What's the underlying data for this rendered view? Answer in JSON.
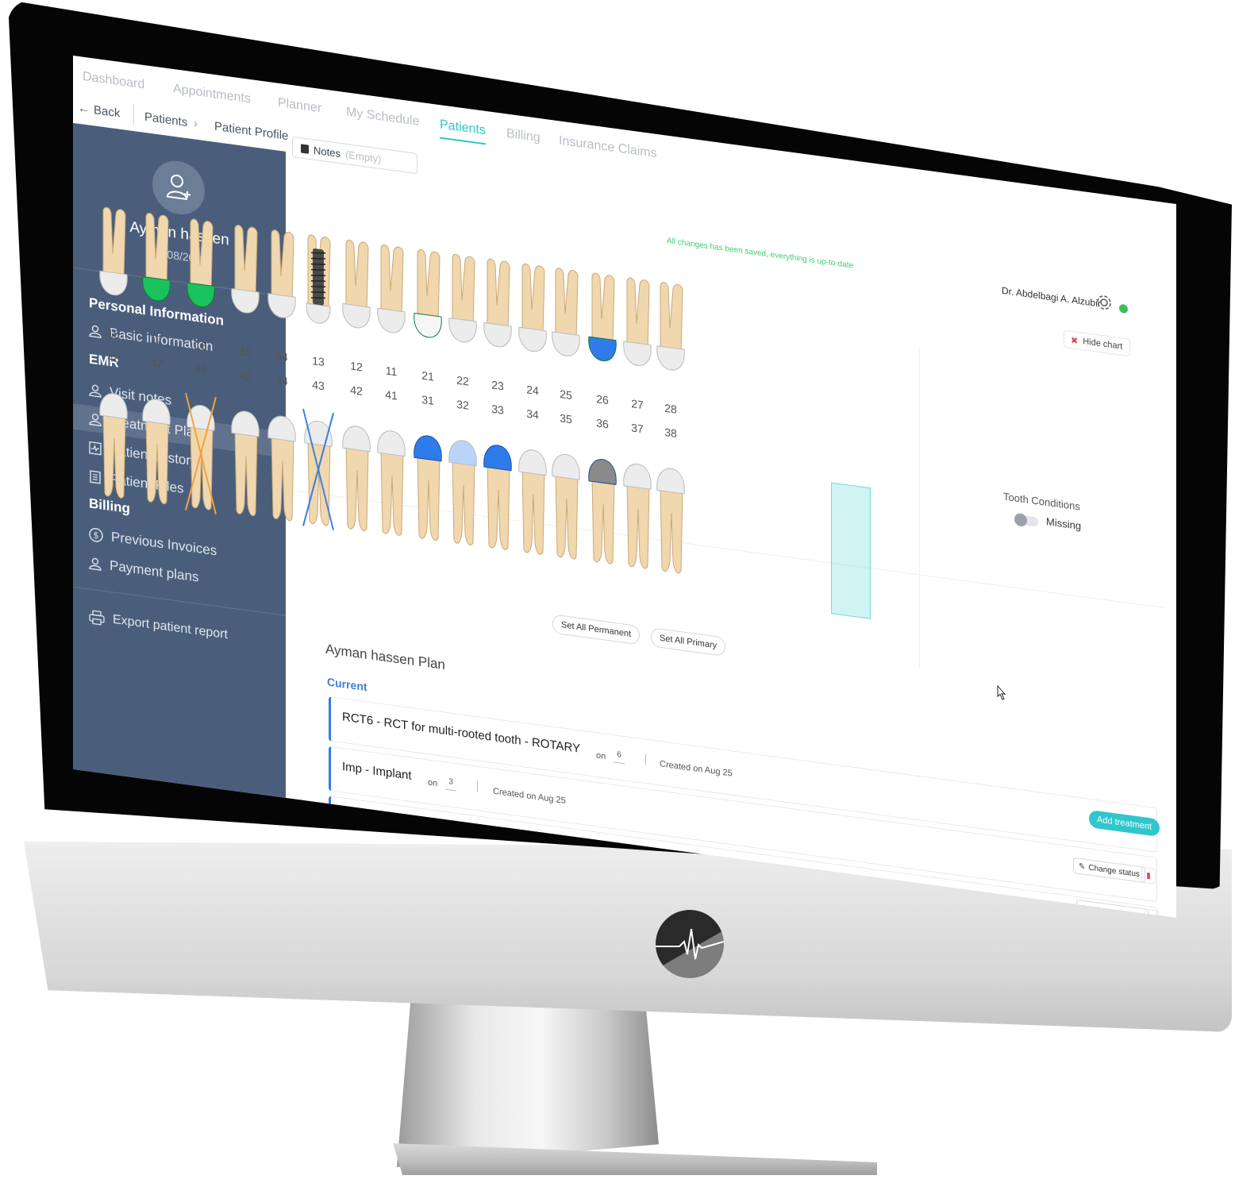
{
  "colors": {
    "accent": "#2fc4c9",
    "sidebar": "#4a5e7c",
    "primary_blue": "#3b7fe0",
    "saved_green": "#3fcf72"
  },
  "topnav": {
    "tabs": [
      "Dashboard",
      "Appointments",
      "Planner",
      "My Schedule",
      "Patients",
      "Billing",
      "Insurance Claims"
    ],
    "active": "Patients"
  },
  "breadcrumb": {
    "back": "Back",
    "items": [
      "Patients",
      "Patient Profile"
    ]
  },
  "patient": {
    "name": "Ayman hassen",
    "dob": "22/08/2009"
  },
  "sidebar": {
    "personal_heading": "Personal Information",
    "basic_info": "Basic information",
    "emr_heading": "EMR",
    "visit_notes": "Visit notes",
    "treatment_plan": "Treatment Plan",
    "patient_history": "Patient History",
    "patient_files": "Patient Files",
    "billing_heading": "Billing",
    "previous_invoices": "Previous Invoices",
    "payment_plans": "Payment plans",
    "export": "Export patient report"
  },
  "notes": {
    "label": "Notes",
    "value": "(Empty)"
  },
  "status": {
    "saved": "All changes has been saved, everything is up-to-date",
    "doctor": "Dr. Abdelbagi A. Alzubir"
  },
  "chart": {
    "hide_chart": "Hide chart",
    "upper_numbers": [
      "18",
      "17",
      "16",
      "15",
      "54",
      "13",
      "12",
      "11",
      "21",
      "22",
      "23",
      "24",
      "25",
      "26",
      "27",
      "28"
    ],
    "lower_numbers": [
      "48",
      "47",
      "46",
      "45",
      "44",
      "43",
      "42",
      "41",
      "31",
      "32",
      "33",
      "34",
      "35",
      "36",
      "37",
      "38"
    ],
    "selected_tooth": "37",
    "set_all_permanent": "Set All Permanent",
    "set_all_primary": "Set All Primary",
    "conditions_title": "Tooth Conditions",
    "condition_missing": "Missing"
  },
  "plan": {
    "title": "Ayman hassen Plan",
    "section": "Current",
    "add_treatment": "Add treatment",
    "rows": [
      {
        "code": "RCT6",
        "description": "RCT for multi-rooted tooth - ROTARY",
        "on_label": "on",
        "tooth": "6",
        "created": "Created on Aug 25"
      },
      {
        "code": "Imp",
        "description": "Implant",
        "on_label": "on",
        "tooth": "3",
        "created": "Created on Aug 25",
        "action": "Change status"
      },
      {
        "action": "Change status"
      }
    ]
  }
}
